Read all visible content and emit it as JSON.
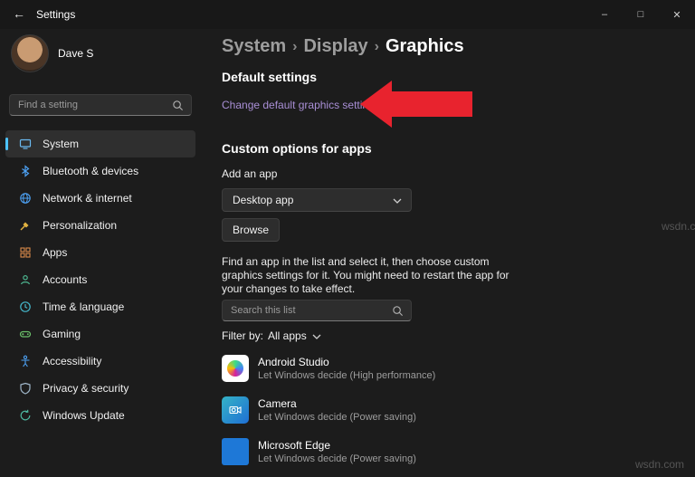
{
  "colors": {
    "accent_pill": "#4cc2ff",
    "link": "#a98fd6",
    "annotation_arrow_red": "#e8232e",
    "edge_icon_blue": "#1e78d7"
  },
  "titlebar": {
    "back_glyph": "←",
    "title": "Settings",
    "minimize_glyph": "–",
    "maximize_glyph": "□",
    "close_glyph": "✕"
  },
  "sidebar": {
    "user_name": "Dave S",
    "search_placeholder": "Find a setting",
    "items": [
      {
        "label": "System",
        "icon": "system-icon",
        "selected": true
      },
      {
        "label": "Bluetooth & devices",
        "icon": "bluetooth-icon",
        "selected": false
      },
      {
        "label": "Network & internet",
        "icon": "network-icon",
        "selected": false
      },
      {
        "label": "Personalization",
        "icon": "personalization-icon",
        "selected": false
      },
      {
        "label": "Apps",
        "icon": "apps-icon",
        "selected": false
      },
      {
        "label": "Accounts",
        "icon": "accounts-icon",
        "selected": false
      },
      {
        "label": "Time & language",
        "icon": "time-language-icon",
        "selected": false
      },
      {
        "label": "Gaming",
        "icon": "gaming-icon",
        "selected": false
      },
      {
        "label": "Accessibility",
        "icon": "accessibility-icon",
        "selected": false
      },
      {
        "label": "Privacy & security",
        "icon": "privacy-icon",
        "selected": false
      },
      {
        "label": "Windows Update",
        "icon": "windows-update-icon",
        "selected": false
      }
    ]
  },
  "main": {
    "breadcrumb": {
      "crumbs": [
        "System",
        "Display",
        "Graphics"
      ],
      "separator": "›"
    },
    "default_settings_heading": "Default settings",
    "change_defaults_link": "Change default graphics settings",
    "custom_options_heading": "Custom options for apps",
    "add_app_label": "Add an app",
    "app_type_value": "Desktop app",
    "browse_label": "Browse",
    "description": "Find an app in the list and select it, then choose custom graphics settings for it. You might need to restart the app for your changes to take effect.",
    "list_search_placeholder": "Search this list",
    "filter_label": "Filter by:",
    "filter_value": "All apps",
    "apps": [
      {
        "name": "Android Studio",
        "icon": "android-studio-icon",
        "status": "Let Windows decide (High performance)"
      },
      {
        "name": "Camera",
        "icon": "camera-icon",
        "status": "Let Windows decide (Power saving)"
      },
      {
        "name": "Microsoft Edge",
        "icon": "microsoft-edge-icon",
        "status": "Let Windows decide (Power saving)"
      }
    ]
  },
  "watermark": "wsdn.com"
}
